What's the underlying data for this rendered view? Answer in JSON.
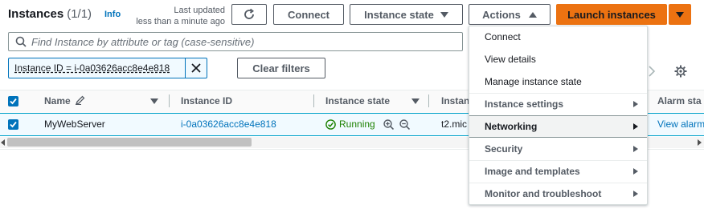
{
  "header": {
    "title": "Instances",
    "count": "(1/1)",
    "info": "Info",
    "updated_line1": "Last updated",
    "updated_line2": "less than a minute ago"
  },
  "toolbar": {
    "connect": "Connect",
    "instance_state": "Instance state",
    "actions": "Actions",
    "launch": "Launch instances"
  },
  "search": {
    "placeholder": "Find Instance by attribute or tag (case-sensitive)"
  },
  "filter": {
    "token": "Instance ID = i-0a03626acc8e4e818",
    "clear": "Clear filters"
  },
  "table": {
    "columns": [
      "Name",
      "Instance ID",
      "Instance state",
      "Instan",
      "Alarm sta"
    ],
    "rows": [
      {
        "name": "MyWebServer",
        "instance_id": "i-0a03626acc8e4e818",
        "state": "Running",
        "type": "t2.mic",
        "alarm": "View alarm"
      }
    ]
  },
  "actions_menu": {
    "items": [
      "Connect",
      "View details",
      "Manage instance state",
      "Instance settings",
      "Networking",
      "Security",
      "Image and templates",
      "Monitor and troubleshoot"
    ],
    "highlighted": "Networking"
  },
  "colors": {
    "accent": "#0073bb",
    "launch_button": "#ec7211",
    "running": "#1d8102",
    "selected_row": "#f1faff"
  }
}
